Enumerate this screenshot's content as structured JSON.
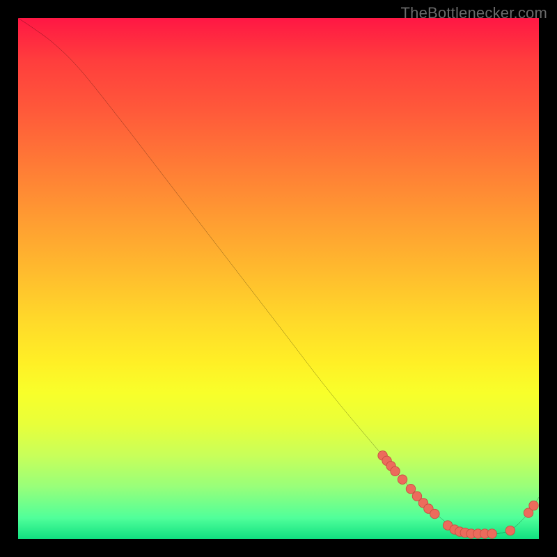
{
  "watermark": "TheBottlenecker.com",
  "colors": {
    "marker_fill": "#ec6b5c",
    "marker_stroke": "#c94f43",
    "curve_stroke": "#000000"
  },
  "chart_data": {
    "type": "line",
    "title": "",
    "xlabel": "",
    "ylabel": "",
    "xlim": [
      0,
      100
    ],
    "ylim": [
      0,
      100
    ],
    "curve": [
      {
        "x": 0,
        "y": 100
      },
      {
        "x": 3,
        "y": 98
      },
      {
        "x": 7,
        "y": 95
      },
      {
        "x": 12,
        "y": 90
      },
      {
        "x": 20,
        "y": 80
      },
      {
        "x": 30,
        "y": 67
      },
      {
        "x": 40,
        "y": 54
      },
      {
        "x": 50,
        "y": 41
      },
      {
        "x": 60,
        "y": 28
      },
      {
        "x": 70,
        "y": 16
      },
      {
        "x": 76,
        "y": 9
      },
      {
        "x": 80,
        "y": 5
      },
      {
        "x": 84,
        "y": 2
      },
      {
        "x": 88,
        "y": 1
      },
      {
        "x": 92,
        "y": 1
      },
      {
        "x": 95,
        "y": 2
      },
      {
        "x": 98,
        "y": 5
      },
      {
        "x": 100,
        "y": 8
      }
    ],
    "markers": [
      {
        "x": 70.0,
        "y": 16.0
      },
      {
        "x": 70.8,
        "y": 15.0
      },
      {
        "x": 71.6,
        "y": 14.0
      },
      {
        "x": 72.4,
        "y": 13.0
      },
      {
        "x": 73.8,
        "y": 11.4
      },
      {
        "x": 75.4,
        "y": 9.6
      },
      {
        "x": 76.6,
        "y": 8.2
      },
      {
        "x": 77.8,
        "y": 6.9
      },
      {
        "x": 78.8,
        "y": 5.8
      },
      {
        "x": 80.0,
        "y": 4.8
      },
      {
        "x": 82.5,
        "y": 2.6
      },
      {
        "x": 83.8,
        "y": 1.8
      },
      {
        "x": 84.8,
        "y": 1.4
      },
      {
        "x": 85.8,
        "y": 1.2
      },
      {
        "x": 87.0,
        "y": 1.0
      },
      {
        "x": 88.3,
        "y": 1.0
      },
      {
        "x": 89.6,
        "y": 1.0
      },
      {
        "x": 91.0,
        "y": 1.0
      },
      {
        "x": 94.5,
        "y": 1.6
      },
      {
        "x": 98.0,
        "y": 5.0
      },
      {
        "x": 99.0,
        "y": 6.4
      }
    ]
  }
}
